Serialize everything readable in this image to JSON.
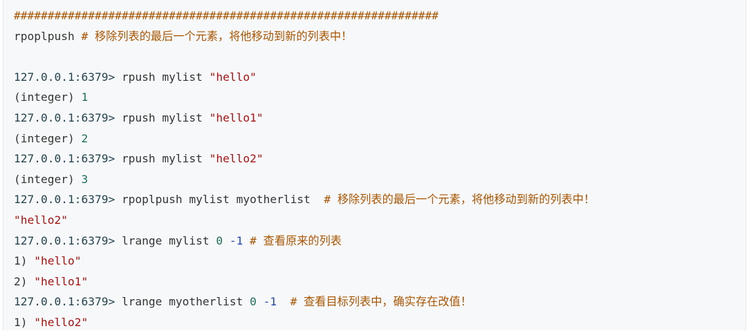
{
  "colors": {
    "background": "#f6f8fa",
    "prompt": "#24434c",
    "string": "#a11111",
    "number": "#1f6f5b",
    "comment": "#aa5500"
  },
  "code": {
    "hash_line": "###############################################################",
    "line1_cmd": "rpoplpush",
    "line1_comment": "# 移除列表的最后一个元素，将他移动到新的列表中！",
    "prompt": "127.0.0.1:6379>",
    "cmd_rpush": "rpush mylist",
    "str_hello": "\"hello\"",
    "str_hello1": "\"hello1\"",
    "str_hello2": "\"hello2\"",
    "int_label": "(integer)",
    "int1": "1",
    "int2": "2",
    "int3": "3",
    "cmd_rpoplpush": "rpoplpush mylist myotherlist",
    "comment_rpoplpush": "# 移除列表的最后一个元素，将他移动到新的列表中！",
    "result_hello2": "\"hello2\"",
    "cmd_lrange_mylist": "lrange mylist",
    "zero": "0",
    "neg_one": "-1",
    "comment_lrange1": "# 查看原来的列表",
    "item1_index": "1)",
    "item2_index": "2)",
    "cmd_lrange_other": "lrange myotherlist",
    "comment_lrange2": "# 查看目标列表中，确实存在改值！"
  }
}
